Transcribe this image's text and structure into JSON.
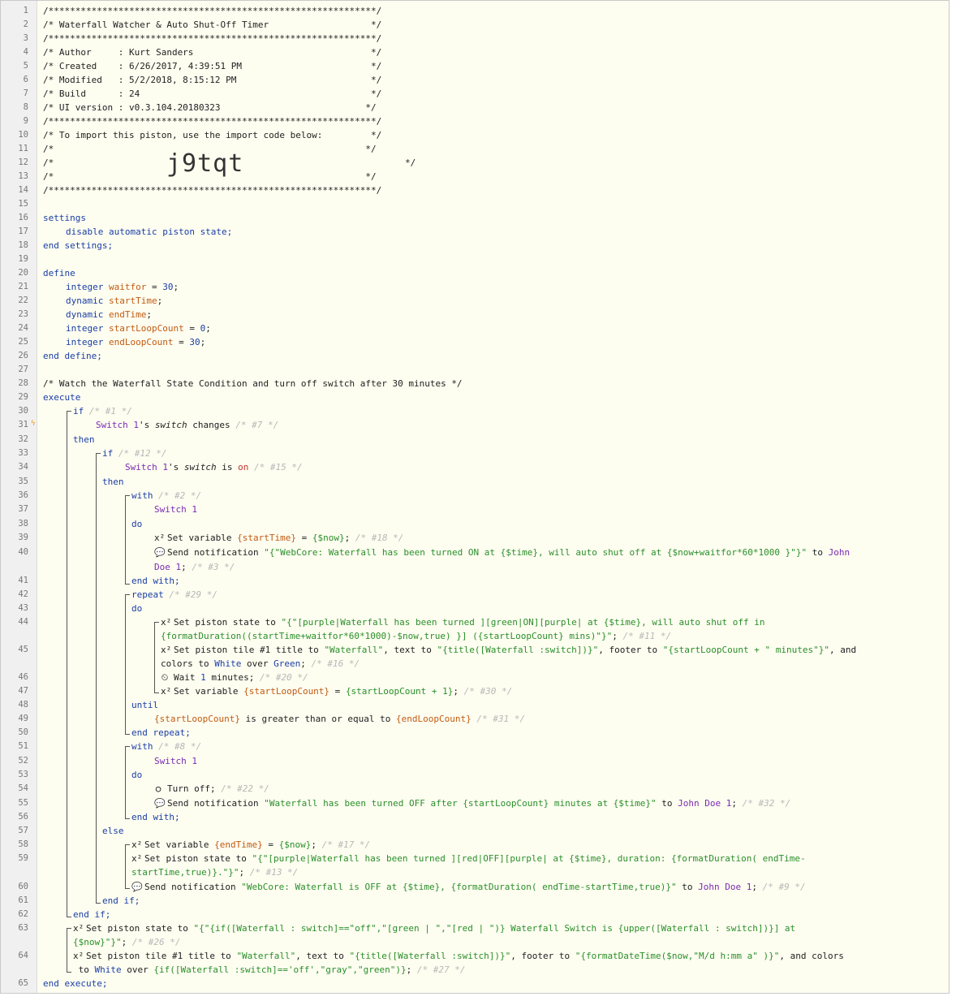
{
  "gutter": {
    "line_numbers": [
      "1",
      "2",
      "3",
      "4",
      "5",
      "6",
      "7",
      "8",
      "9",
      "10",
      "11",
      "12",
      "13",
      "14",
      "15",
      "16",
      "17",
      "18",
      "19",
      "20",
      "21",
      "22",
      "23",
      "24",
      "25",
      "26",
      "27",
      "28",
      "29",
      "30",
      "31",
      "32",
      "33",
      "34",
      "35",
      "36",
      "37",
      "38",
      "39",
      "40",
      "41",
      "42",
      "43",
      "44",
      "45",
      "46",
      "47",
      "48",
      "49",
      "50",
      "51",
      "52",
      "53",
      "54",
      "55",
      "56",
      "57",
      "58",
      "59",
      "60",
      "61",
      "62",
      "63",
      "64",
      "65"
    ]
  },
  "header": {
    "stars": "/*************************************************************/",
    "title": "/* Waterfall Watcher & Auto Shut-Off Timer                   */",
    "author": "/* Author     : Kurt Sanders                                 */",
    "created": "/* Created    : 6/26/2017, 4:39:51 PM                        */",
    "modified": "/* Modified   : 5/2/2018, 8:15:12 PM                         */",
    "build": "/* Build      : 24                                           */",
    "ui_version": "/* UI version : v0.3.104.20180323                           */",
    "import_hint": "/* To import this piston, use the import code below:         */",
    "blank_comment": "/*                                                          */",
    "comment_open": "/*",
    "comment_close": "*/",
    "import_code": "j9tqt"
  },
  "settings": {
    "open": "settings",
    "body": "disable automatic piston state;",
    "close": "end settings;"
  },
  "define": {
    "open": "define",
    "close": "end define;",
    "vars": [
      {
        "type": "integer",
        "name": "waitfor",
        "assign": " = ",
        "value": "30",
        "end": ";"
      },
      {
        "type": "dynamic",
        "name": "startTime",
        "assign": "",
        "value": "",
        "end": ";"
      },
      {
        "type": "dynamic",
        "name": "endTime",
        "assign": "",
        "value": "",
        "end": ";"
      },
      {
        "type": "integer",
        "name": "startLoopCount",
        "assign": " = ",
        "value": "0",
        "end": ";"
      },
      {
        "type": "integer",
        "name": "endLoopCount",
        "assign": " = ",
        "value": "30",
        "end": ";"
      }
    ]
  },
  "main_comment": "/* Watch the Waterfall State Condition and turn off switch after 30 minutes */",
  "code": {
    "execute": "execute",
    "end_execute": "end execute;",
    "if": "if",
    "then": "then",
    "else": "else",
    "end_if": "end if;",
    "with": "with",
    "do": "do",
    "end_with": "end with;",
    "repeat": "repeat",
    "until": "until",
    "end_repeat": "end repeat;",
    "device": "Switch 1",
    "c1": "/* #1 */",
    "c7": "/* #7 */",
    "c12": "/* #12 */",
    "c15": "/* #15 */",
    "c2": "/* #2 */",
    "c18": "/* #18 */",
    "c3": "/* #3 */",
    "c29": "/* #29 */",
    "c11": "/* #11 */",
    "c16": "/* #16 */",
    "c20": "/* #20 */",
    "c30": "/* #30 */",
    "c31": "/* #31 */",
    "c8": "/* #8 */",
    "c22": "/* #22 */",
    "c32": "/* #32 */",
    "c17": "/* #17 */",
    "c13": "/* #13 */",
    "c9": "/* #9 */",
    "c26": "/* #26 */",
    "c27": "/* #27 */",
    "l31_dev": "Switch 1",
    "l31_rest": "'s ",
    "l31_attr": "switch",
    "l31_op": " changes ",
    "l34_rest": "'s ",
    "l34_attr": "switch",
    "l34_op": " is ",
    "l34_val": "on",
    "set_var": "Set variable ",
    "v_startTime": "{startTime}",
    "eq": " = ",
    "now": "{$now}",
    "semi": ";",
    "send_notif": "Send notification ",
    "l40_str": "\"{\"WebCore: Waterfall has been turned ON at {$time}, will auto shut off at {$now+waitfor*60*1000 }\"}\"",
    "to": " to ",
    "john_a": "John",
    "john_b": "Doe 1",
    "set_state": "Set piston state to ",
    "l44_str": "\"{\"[purple|Waterfall has been turned ][green|ON][purple| at {$time}, will auto shut off in",
    "l44b_str": "{formatDuration((startTime+waitfor*60*1000)-$now,true) }] ({startLoopCount} mins)\"}\"",
    "set_tile": "Set piston tile #1 title to ",
    "waterfall": "\"Waterfall\"",
    "text_to": ", text to ",
    "l45_text": "\"{title([Waterfall :switch])}\"",
    "footer_to": ", footer to ",
    "l45_footer": "\"{startLoopCount + \" minutes\"}\"",
    "and": ", and",
    "colors_to": "colors to ",
    "white": "White",
    "over": " over ",
    "green": "Green",
    "wait": "Wait ",
    "one": "1",
    "minutes": " minutes;",
    "v_slc": "{startLoopCount}",
    "l47_val": "{startLoopCount + 1}",
    "v_elc": "{endLoopCount}",
    "gte": " is greater than or equal to ",
    "turn_off": "Turn off;",
    "l55_str": "\"Waterfall has been turned OFF after {startLoopCount} minutes at {$time}\"",
    "john_full": "John Doe 1",
    "v_endTime": "{endTime}",
    "l59_str": "\"{\"[purple|Waterfall has been turned ][red|OFF][purple| at {$time}, duration: {formatDuration( endTime-",
    "l59b_str": "startTime,true)}.\"}\"",
    "l60_str": "\"WebCore: Waterfall is OFF at {$time}, {formatDuration( endTime-startTime,true)}\"",
    "l63_str": "\"{\"{if([Waterfall : switch]==\"off\",\"[green | \",\"[red | \")} Waterfall Switch is {upper([Waterfall : switch])}] at",
    "l63b_str": "{$now}\"}\"",
    "l64_footer": "\"{formatDateTime($now,\"M/d h:mm a\" )}\"",
    "and_colors": ", and colors",
    "l64_expr": "{if([Waterfall :switch]=='off',\"gray\",\"green\")}"
  },
  "icons": {
    "variable": "x²",
    "notification": "💬",
    "wait": "⏲",
    "power": "○",
    "bolt": "ϟ"
  }
}
